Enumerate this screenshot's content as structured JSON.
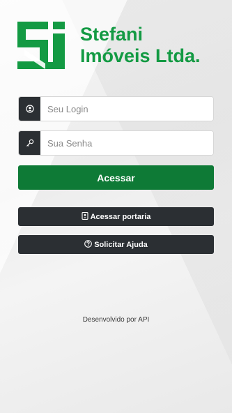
{
  "brand": {
    "name_line1": "Stefani",
    "name_line2": "Imóveis Ltda.",
    "color": "#139a43"
  },
  "login": {
    "icon": "user-circle-icon",
    "placeholder": "Seu Login",
    "value": ""
  },
  "password": {
    "icon": "key-icon",
    "placeholder": "Sua Senha",
    "value": ""
  },
  "buttons": {
    "submit_label": "Acessar",
    "submit_color": "#0e7a36",
    "portaria_label": "Acessar portaria",
    "portaria_icon": "id-badge-icon",
    "help_label": "Solicitar Ajuda",
    "help_icon": "question-circle-icon",
    "dark_color": "#2b2f33"
  },
  "footer": {
    "text": "Desenvolvido por API"
  }
}
